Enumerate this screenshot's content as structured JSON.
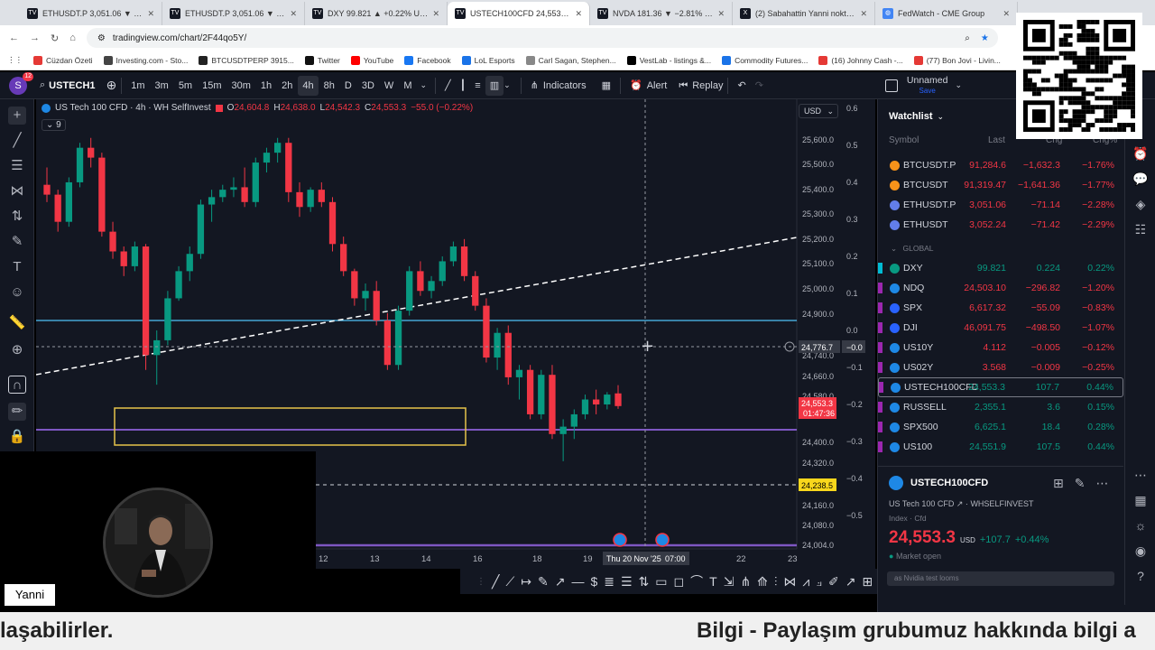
{
  "browser": {
    "tabs": [
      {
        "label": "ETHUSDT.P 3,051.06 ▼ −2.28%",
        "icon": "tradingview"
      },
      {
        "label": "ETHUSDT.P 3,051.06 ▼ −2.28%",
        "icon": "tradingview"
      },
      {
        "label": "DXY 99.821 ▲ +0.22% Unname",
        "icon": "tradingview"
      },
      {
        "label": "USTECH100CFD 24,553.3 ▲ +0",
        "icon": "tradingview"
      },
      {
        "label": "NVDA 181.36 ▼ −2.81% Unna",
        "icon": "tradingview"
      },
      {
        "label": "(2) Sabahattin Yanni nokta Eteh",
        "icon": "x"
      },
      {
        "label": "FedWatch - CME Group",
        "icon": "globe"
      }
    ],
    "active_tab": 3,
    "url": "tradingview.com/chart/2F44qo5Y/",
    "bookmarks": [
      "Cüzdan Özeti",
      "Investing.com - Sto...",
      "BTCUSDTPERP 3915...",
      "Twitter",
      "YouTube",
      "Facebook",
      "LoL Esports",
      "Carl Sagan, Stephen...",
      "VestLab - listings &...",
      "Commodity Futures...",
      "(16) Johnny Cash -...",
      "(77) Bon Jovi - Livin..."
    ]
  },
  "toolbar": {
    "avatar_letter": "S",
    "avatar_badge": "12",
    "symbol": "USTECH1",
    "intervals": [
      "1m",
      "3m",
      "5m",
      "15m",
      "30m",
      "1h",
      "2h",
      "4h",
      "8h",
      "D",
      "3D",
      "W",
      "M"
    ],
    "selected_interval": "4h",
    "indicators_label": "Indicators",
    "alert_label": "Alert",
    "replay_label": "Replay",
    "layout_name": "Unnamed",
    "layout_sub": "Save"
  },
  "chart": {
    "legend_title": "US Tech 100 CFD · 4h · WH SelfInvest",
    "ohlc": {
      "o_label": "O",
      "o": "24,604.8",
      "h_label": "H",
      "h": "24,638.0",
      "l_label": "L",
      "l": "24,542.3",
      "c_label": "C",
      "c": "24,553.3",
      "chg": "−55.0 (−0.22%)"
    },
    "indicator_count": "9",
    "currency": "USD",
    "price_ticks": [
      "25,600.0",
      "25,500.0",
      "25,400.0",
      "25,300.0",
      "25,200.0",
      "25,100.0",
      "25,000.0",
      "24,900.0",
      "24,740.0",
      "24,660.0",
      "24,580.0",
      "24,400.0",
      "24,320.0",
      "24,160.0",
      "24,080.0",
      "24,004.0"
    ],
    "pct_ticks": [
      "0.6",
      "0.5",
      "0.4",
      "0.3",
      "0.2",
      "0.1",
      "0.0",
      "−0.1",
      "−0.2",
      "−0.3",
      "−0.4",
      "−0.5"
    ],
    "crosshair_pct": "−0.0",
    "crosshair_price": "24,776.7",
    "last_price": "24,553.3",
    "countdown": "01:47:36",
    "level_price": "24,238.5",
    "time_ticks": [
      "12",
      "13",
      "14",
      "16",
      "18",
      "19",
      "22",
      "23"
    ],
    "crosshair_time": "Thu 20 Nov '25",
    "crosshair_time2": "07:00"
  },
  "chart_data": {
    "type": "candlestick",
    "interval": "4h",
    "symbol": "US Tech 100 CFD",
    "yrange": [
      24004,
      25650
    ],
    "candles": [
      [
        25450,
        25520,
        25380,
        25410
      ],
      [
        25410,
        25430,
        25260,
        25300
      ],
      [
        25300,
        25480,
        25280,
        25460
      ],
      [
        25460,
        25620,
        25440,
        25600
      ],
      [
        25600,
        25640,
        25520,
        25560
      ],
      [
        25560,
        25580,
        25240,
        25260
      ],
      [
        25260,
        25300,
        25150,
        25180
      ],
      [
        25180,
        25200,
        25080,
        25120
      ],
      [
        25120,
        25220,
        25100,
        25200
      ],
      [
        25200,
        25210,
        24700,
        24760
      ],
      [
        24760,
        24860,
        24640,
        24820
      ],
      [
        24820,
        25020,
        24800,
        24990
      ],
      [
        24990,
        25120,
        24980,
        25100
      ],
      [
        25100,
        25200,
        25060,
        25170
      ],
      [
        25170,
        25390,
        25150,
        25370
      ],
      [
        25370,
        25430,
        25300,
        25400
      ],
      [
        25400,
        25450,
        25380,
        25430
      ],
      [
        25430,
        25480,
        25400,
        25440
      ],
      [
        25440,
        25520,
        25360,
        25380
      ],
      [
        25380,
        25560,
        25360,
        25540
      ],
      [
        25540,
        25600,
        25500,
        25580
      ],
      [
        25580,
        25640,
        25540,
        25620
      ],
      [
        25620,
        25640,
        25380,
        25420
      ],
      [
        25420,
        25460,
        25320,
        25360
      ],
      [
        25360,
        25440,
        25340,
        25430
      ],
      [
        25430,
        25460,
        25360,
        25380
      ],
      [
        25380,
        25400,
        25180,
        25210
      ],
      [
        25210,
        25240,
        25080,
        25100
      ],
      [
        25100,
        25110,
        24960,
        24990
      ],
      [
        24990,
        25050,
        24940,
        25020
      ],
      [
        25020,
        25060,
        24880,
        24900
      ],
      [
        24900,
        24930,
        24700,
        24720
      ],
      [
        24720,
        24960,
        24700,
        24940
      ],
      [
        24940,
        25120,
        24920,
        25100
      ],
      [
        25100,
        25140,
        25000,
        25020
      ],
      [
        25020,
        25080,
        24990,
        25060
      ],
      [
        25060,
        25160,
        25040,
        25140
      ],
      [
        25140,
        25220,
        25120,
        25200
      ],
      [
        25200,
        25230,
        25060,
        25080
      ],
      [
        25080,
        25100,
        24940,
        24960
      ],
      [
        24960,
        24990,
        24730,
        24750
      ],
      [
        24750,
        24870,
        24700,
        24850
      ],
      [
        24850,
        24880,
        24640,
        24670
      ],
      [
        24670,
        24720,
        24580,
        24700
      ],
      [
        24700,
        24720,
        24500,
        24520
      ],
      [
        24520,
        24700,
        24500,
        24680
      ],
      [
        24680,
        24720,
        24420,
        24440
      ],
      [
        24440,
        24500,
        24330,
        24470
      ],
      [
        24470,
        24540,
        24420,
        24520
      ],
      [
        24520,
        24600,
        24500,
        24580
      ],
      [
        24580,
        24620,
        24520,
        24560
      ],
      [
        24560,
        24610,
        24540,
        24600
      ],
      [
        24604.8,
        24638.0,
        24542.3,
        24553.3
      ]
    ]
  },
  "watchlist": {
    "title": "Watchlist",
    "cols": [
      "Symbol",
      "Last",
      "Chg",
      "Chg%"
    ],
    "group": "GLOBAL",
    "rows": [
      {
        "sym": "BTCUSDT.P",
        "last": "91,284.6",
        "chg": "−1,632.3",
        "pct": "−1.76%",
        "dir": "down",
        "icon": "btc"
      },
      {
        "sym": "BTCUSDT",
        "last": "91,319.47",
        "chg": "−1,641.36",
        "pct": "−1.77%",
        "dir": "down",
        "icon": "btc"
      },
      {
        "sym": "ETHUSDT.P",
        "last": "3,051.06",
        "chg": "−71.14",
        "pct": "−2.28%",
        "dir": "down",
        "icon": "eth"
      },
      {
        "sym": "ETHUSDT",
        "last": "3,052.24",
        "chg": "−71.42",
        "pct": "−2.29%",
        "dir": "down",
        "icon": "eth"
      },
      {
        "sym": "DXY",
        "last": "99.821",
        "chg": "0.224",
        "pct": "0.22%",
        "dir": "up",
        "icon": "dxy"
      },
      {
        "sym": "NDQ",
        "last": "24,503.10",
        "chg": "−296.82",
        "pct": "−1.20%",
        "dir": "down",
        "icon": "ndq"
      },
      {
        "sym": "SPX",
        "last": "6,617.32",
        "chg": "−55.09",
        "pct": "−0.83%",
        "dir": "down",
        "icon": "spx"
      },
      {
        "sym": "DJI",
        "last": "46,091.75",
        "chg": "−498.50",
        "pct": "−1.07%",
        "dir": "down",
        "icon": "dji"
      },
      {
        "sym": "US10Y",
        "last": "4.112",
        "chg": "−0.005",
        "pct": "−0.12%",
        "dir": "down",
        "icon": "us"
      },
      {
        "sym": "US02Y",
        "last": "3.568",
        "chg": "−0.009",
        "pct": "−0.25%",
        "dir": "down",
        "icon": "us"
      },
      {
        "sym": "USTECH100CFD",
        "last": "24,553.3",
        "chg": "107.7",
        "pct": "0.44%",
        "dir": "up",
        "icon": "us"
      },
      {
        "sym": "RUSSELL",
        "last": "2,355.1",
        "chg": "3.6",
        "pct": "0.15%",
        "dir": "up",
        "icon": "us"
      },
      {
        "sym": "SPX500",
        "last": "6,625.1",
        "chg": "18.4",
        "pct": "0.28%",
        "dir": "up",
        "icon": "us"
      },
      {
        "sym": "US100",
        "last": "24,551.9",
        "chg": "107.5",
        "pct": "0.44%",
        "dir": "up",
        "icon": "us"
      }
    ]
  },
  "detail": {
    "symbol": "USTECH100CFD",
    "name": "US Tech 100 CFD",
    "exchange": "WHSELFINVEST",
    "type": "Index · Cfd",
    "price": "24,553.3",
    "currency": "USD",
    "chg": "+107.7",
    "pct": "+0.44%",
    "status": "Market open",
    "news": "as Nvidia test looms"
  },
  "overlay": {
    "streamer_name": "Yanni",
    "ticker_left": "laşabilirler.",
    "ticker_right": "Bilgi - Paylaşım grubumuz hakkında bilgi a"
  },
  "colors": {
    "up": "#089981",
    "down": "#f23645",
    "bg": "#131722",
    "accent": "#2962ff"
  }
}
